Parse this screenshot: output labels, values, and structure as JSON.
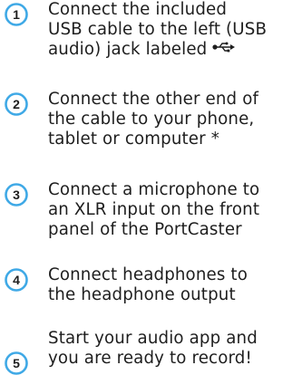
{
  "accent_color": "#3fa9e6",
  "steps": [
    {
      "number": "1",
      "lines": [
        "Connect the included",
        "USB cable to the left (USB",
        "audio) jack labeled"
      ],
      "trailing_icon": "usb-icon"
    },
    {
      "number": "2",
      "lines": [
        "Connect the other end of",
        "the cable to your phone,",
        "tablet or computer *"
      ]
    },
    {
      "number": "3",
      "lines": [
        "Connect a microphone to",
        "an XLR input on the front",
        "panel of the PortCaster"
      ]
    },
    {
      "number": "4",
      "lines": [
        "Connect headphones to",
        "the headphone output"
      ]
    },
    {
      "number": "5",
      "lines": [
        "Start your audio app and",
        "you are ready to record!"
      ]
    }
  ]
}
